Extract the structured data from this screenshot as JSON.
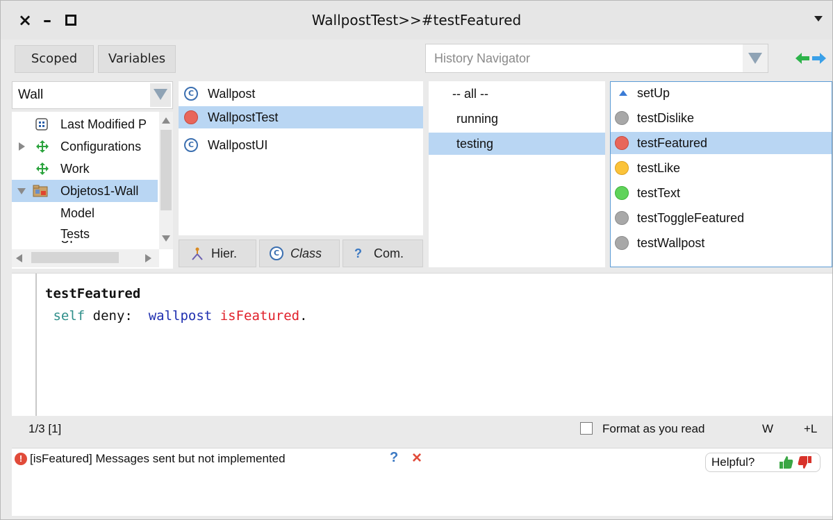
{
  "window": {
    "title": "WallpostTest>>#testFeatured",
    "controls": {
      "close": "×",
      "minimize": "–"
    }
  },
  "toolbar": {
    "scoped_label": "Scoped",
    "variables_label": "Variables",
    "history_placeholder": "History Navigator"
  },
  "package_pane": {
    "filter_value": "Wall",
    "items": [
      {
        "label": "Last Modified P",
        "icon": "grid-icon"
      },
      {
        "label": "Configurations",
        "icon": "config-icon"
      },
      {
        "label": "Work",
        "icon": "config-icon"
      },
      {
        "label": "Objetos1-Wall",
        "icon": "package-icon",
        "selected": true
      },
      {
        "label": "Model"
      },
      {
        "label": "Tests"
      },
      {
        "label": "UI"
      }
    ]
  },
  "class_pane": {
    "items": [
      {
        "label": "Wallpost",
        "icon": "class-icon"
      },
      {
        "label": "WallpostTest",
        "icon": "test-failure-icon",
        "selected": true
      },
      {
        "label": "WallpostUI",
        "icon": "class-icon"
      }
    ],
    "buttons": {
      "hier": "Hier.",
      "class": "Class",
      "com": "Com."
    }
  },
  "protocol_pane": {
    "items": [
      {
        "label": "-- all --"
      },
      {
        "label": "running"
      },
      {
        "label": "testing",
        "selected": true
      }
    ]
  },
  "method_pane": {
    "items": [
      {
        "label": "setUp",
        "status": "override"
      },
      {
        "label": "testDislike",
        "status": "not-run"
      },
      {
        "label": "testFeatured",
        "status": "failed",
        "selected": true
      },
      {
        "label": "testLike",
        "status": "error"
      },
      {
        "label": "testText",
        "status": "passed"
      },
      {
        "label": "testToggleFeatured",
        "status": "not-run"
      },
      {
        "label": "testWallpost",
        "status": "not-run"
      }
    ]
  },
  "editor": {
    "line1": "testFeatured",
    "line2_self": "self",
    "line2_deny": " deny:  ",
    "line2_var": "wallpost",
    "line2_sel": " isFeatured",
    "line2_end": "."
  },
  "status": {
    "position": "1/3 [1]",
    "format_label": "Format as you read",
    "w_label": "W",
    "l_label": "+L"
  },
  "critic": {
    "message": "[isFeatured] Messages sent but not implemented",
    "help": "?",
    "dismiss": "×",
    "helpful": "Helpful?"
  },
  "colors": {
    "selection": "#b9d6f3",
    "failed": "#e8665a",
    "error": "#fbc33a",
    "passed": "#5fd35a",
    "not_run": "#a8a8a8"
  }
}
